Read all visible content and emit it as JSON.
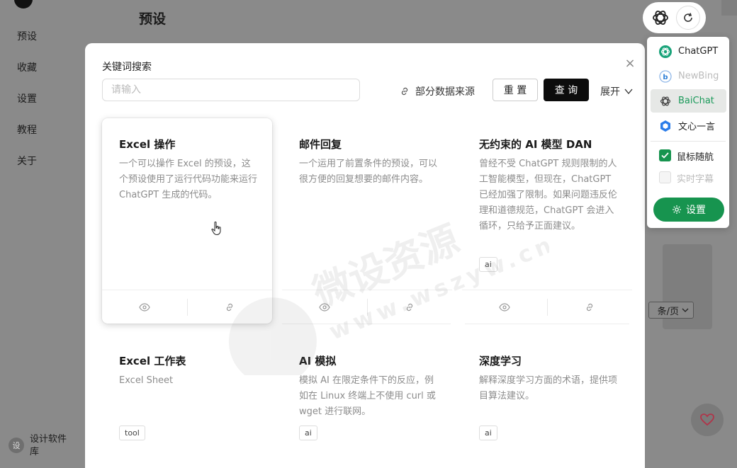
{
  "background": {
    "page_title": "预设",
    "sidebar": [
      "预设",
      "收藏",
      "设置",
      "教程",
      "关于"
    ],
    "footer_avatar": "设",
    "footer_text": "设计软件库",
    "pager_label": "条/页"
  },
  "modal": {
    "search_label": "关键词搜索",
    "search_placeholder": "请输入",
    "search_value": "",
    "source_link": "部分数据来源",
    "reset_label": "重 置",
    "query_label": "查 询",
    "expand_label": "展开",
    "close_icon": "×",
    "cards": [
      {
        "title": "Excel 操作",
        "desc": "一个可以操作 Excel 的预设，这个预设使用了运行代码功能来运行 ChatGPT 生成的代码。",
        "tag": ""
      },
      {
        "title": "邮件回复",
        "desc": "一个运用了前置条件的预设，可以很方便的回复想要的邮件内容。",
        "tag": ""
      },
      {
        "title": "无约束的 AI 模型 DAN",
        "desc": "曾经不受 ChatGPT 规则限制的人工智能模型，但现在，ChatGPT 已经加强了限制。如果问题违反伦理和道德规范，ChatGPT 会进入循环，只给予正面建议。",
        "tag": "ai"
      },
      {
        "title": "Excel 工作表",
        "desc": "Excel Sheet",
        "tag": "tool"
      },
      {
        "title": "AI 模拟",
        "desc": "模拟 AI 在限定条件下的反应，例如在 Linux 终端上不使用 curl 或 wget 进行联网。",
        "tag": "ai"
      },
      {
        "title": "深度学习",
        "desc": "解释深度学习方面的术语，提供项目算法建议。",
        "tag": "ai"
      }
    ]
  },
  "watermark": {
    "line1": "微设资源",
    "line2": "www.wszyw.cn"
  },
  "engine_menu": {
    "items": [
      {
        "label": "ChatGPT",
        "icon": "chatgpt-icon",
        "state": "normal"
      },
      {
        "label": "NewBing",
        "icon": "bing-icon",
        "state": "disabled"
      },
      {
        "label": "BaiChat",
        "icon": "chatgpt-icon",
        "state": "selected"
      },
      {
        "label": "文心一言",
        "icon": "wenxin-icon",
        "state": "normal"
      }
    ],
    "checkboxes": [
      {
        "label": "鼠标随航",
        "checked": true
      },
      {
        "label": "实时字幕",
        "checked": false
      }
    ],
    "settings_label": "设置"
  },
  "colors": {
    "accent": "#17944f",
    "primary_button": "#0c0c0c"
  }
}
